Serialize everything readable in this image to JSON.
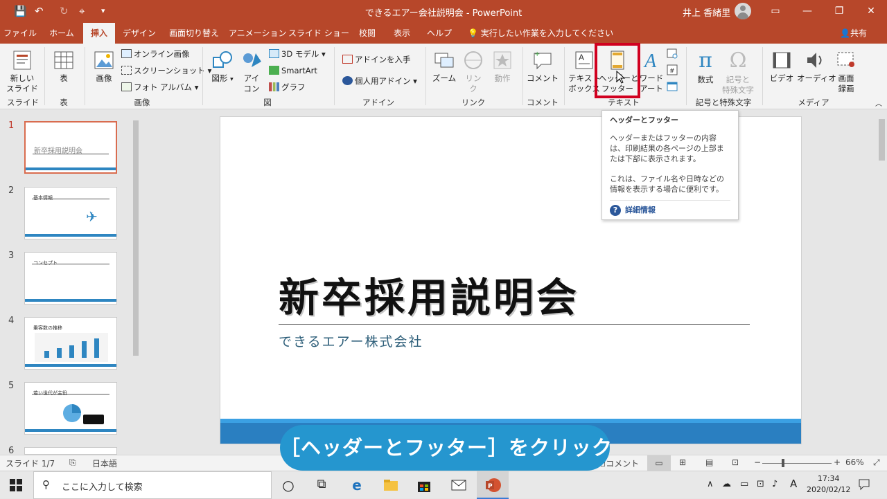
{
  "titlebar": {
    "title": "できるエアー会社説明会  -  PowerPoint",
    "user": "井上 香緒里",
    "qa_save": "💾",
    "qa_undo": "↶",
    "qa_redo": "↻",
    "qa_custom": "▾",
    "win_ribbon": "▭",
    "win_min": "—",
    "win_max": "❐",
    "win_close": "✕"
  },
  "tabs": [
    "ファイル",
    "ホーム",
    "挿入",
    "デザイン",
    "画面切り替え",
    "アニメーション",
    "スライド ショー",
    "校閲",
    "表示",
    "ヘルプ"
  ],
  "tellme": "実行したい作業を入力してください",
  "share": "共有",
  "ribbon": {
    "new_slide": "新しい\nスライド",
    "table": "表",
    "image": "画像",
    "online_image": "オンライン画像",
    "screenshot": "スクリーンショット",
    "photo_album": "フォト アルバム",
    "shapes": "図形",
    "icons": "アイ\nコン",
    "model3d": "3D モデル",
    "smartart": "SmartArt",
    "chart": "グラフ",
    "get_addins": "アドインを入手",
    "my_addins": "個人用アドイン",
    "zoom": "ズーム",
    "link": "リン\nク",
    "action": "動作",
    "comment": "コメント",
    "textbox": "テキスト\nボックス",
    "header_footer": "ヘッダーと\nフッター",
    "wordart": "ワード\nアート",
    "equation": "数式",
    "symbol": "記号と\n特殊文字",
    "video": "ビデオ",
    "audio": "オーディオ",
    "screen_rec": "画面\n録画",
    "groups": {
      "slides": "スライド",
      "tables": "表",
      "images": "画像",
      "illustrations": "図",
      "addins": "アドイン",
      "links": "リンク",
      "comments": "コメント",
      "text": "テキスト",
      "symbols": "記号と特殊文字",
      "media": "メディア"
    }
  },
  "tooltip": {
    "title": "ヘッダーとフッター",
    "p1": "ヘッダーまたはフッターの内容は、印刷結果の各ページの上部または下部に表示されます。",
    "p2": "これは、ファイル名や日時などの情報を表示する場合に便利です。",
    "more": "詳細情報"
  },
  "thumbnails": {
    "numbers": [
      "1",
      "2",
      "3",
      "4",
      "5",
      "6"
    ],
    "t1": "新卒採用説明会",
    "t2": "基本情報",
    "t3": "コンセプト",
    "t4": "乗客数の推移",
    "t5": "若い世代が主役"
  },
  "slide": {
    "title": "新卒採用説明会",
    "subtitle": "できるエアー株式会社"
  },
  "caption": "［ヘッダーとフッター］をクリック",
  "statusbar": {
    "slide_info": "スライド 1/7",
    "language": "日本語",
    "comment": "コメント",
    "zoom": "66%"
  },
  "taskbar": {
    "search_placeholder": "ここに入力して検索",
    "time": "17:34",
    "date": "2020/02/12",
    "ime": "A"
  },
  "colors": {
    "accent": "#b7472a",
    "highlight": "#d1001f",
    "caption_bg": "#2596cf",
    "slide_bar": "#2a7fc1"
  }
}
